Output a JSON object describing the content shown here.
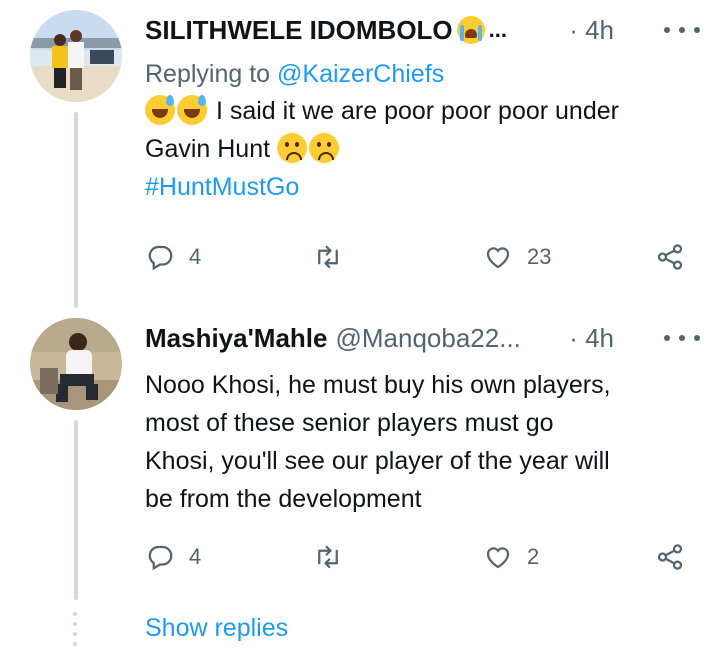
{
  "tweets": [
    {
      "display_name": "SILITHWELE IDOMBOLO",
      "name_suffix": "...",
      "handle": "",
      "time": "· 4h",
      "replying_prefix": "Replying to ",
      "replying_to": "@KaizerChiefs",
      "text_1": " I said it we are poor poor poor under",
      "text_2": "Gavin Hunt ",
      "hashtag": "#HuntMustGo",
      "emojis": [
        "loudly-crying-face",
        "grinning-sweat-face",
        "grinning-sweat-face",
        "slightly-frowning-face",
        "slightly-frowning-face"
      ],
      "reply_count": "4",
      "retweet_count": "",
      "like_count": "23"
    },
    {
      "display_name": "Mashiya'Mahle",
      "handle": "@Manqoba22...",
      "time": "· 4h",
      "lines": [
        "Nooo Khosi,  he must buy his own players,",
        "most of these senior players must go",
        "Khosi, you'll see our player of the year will",
        "be from the development"
      ],
      "reply_count": "4",
      "retweet_count": "",
      "like_count": "2"
    }
  ],
  "show_replies": "Show replies",
  "icons": {
    "reply": "reply-icon",
    "retweet": "retweet-icon",
    "like": "heart-icon",
    "share": "share-icon",
    "more": "more-icon"
  },
  "colors": {
    "accent": "#1d9bf0",
    "secondary_text": "#536471",
    "thread_line": "#cfd9de"
  }
}
